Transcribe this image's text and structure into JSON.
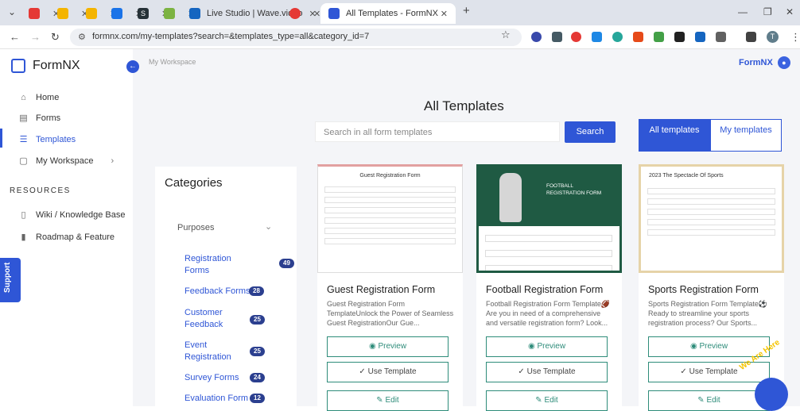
{
  "browser": {
    "tabs": [
      {
        "label": "",
        "color": "#e53935"
      },
      {
        "label": "",
        "color": "#f4b400"
      },
      {
        "label": "",
        "color": "#f4b400"
      },
      {
        "label": "",
        "color": "#1a73e8"
      },
      {
        "label": "S",
        "color": "#263238"
      },
      {
        "label": "",
        "color": "#7cb342"
      },
      {
        "label": "Live Studio | Wave.video",
        "color": "#1565c0"
      },
      {
        "label": "",
        "color": "#e53935"
      }
    ],
    "active_tab": "All Templates - FormNX",
    "new_tab": "+",
    "url": "formnx.com/my-templates?search=&templates_type=all&category_id=7",
    "profile_initial": "T"
  },
  "app": {
    "logo": "FormNX",
    "breadcrumb": "My Workspace",
    "brand_right": "FormNX",
    "nav": [
      {
        "label": "Home",
        "icon": "home-icon",
        "glyph": "⌂"
      },
      {
        "label": "Forms",
        "icon": "forms-icon",
        "glyph": "▤"
      },
      {
        "label": "Templates",
        "icon": "templates-icon",
        "glyph": "☰"
      },
      {
        "label": "My Workspace",
        "icon": "workspace-icon",
        "glyph": "▢"
      }
    ],
    "resources_label": "RESOURCES",
    "resources": [
      {
        "label": "Wiki / Knowledge Base",
        "icon": "book-icon"
      },
      {
        "label": "Roadmap & Feature",
        "icon": "roadmap-icon"
      }
    ],
    "page_title": "All Templates",
    "search_placeholder": "Search in all form templates",
    "search_button": "Search",
    "toggle": {
      "all": "All templates",
      "my": "My templates"
    },
    "support": "Support",
    "widget_text": "We Are Here"
  },
  "categories": {
    "title": "Categories",
    "group": "Purposes",
    "items": [
      {
        "label": "Registration Forms",
        "count": "49"
      },
      {
        "label": "Feedback Forms",
        "count": "28"
      },
      {
        "label": "Customer Feedback",
        "count": "25"
      },
      {
        "label": "Event Registration",
        "count": "25"
      },
      {
        "label": "Survey Forms",
        "count": "24"
      },
      {
        "label": "Evaluation Form",
        "count": "12"
      }
    ]
  },
  "cards": [
    {
      "thumb_title": "Guest Registration Form",
      "title": "Guest Registration Form",
      "desc": "Guest Registration Form TemplateUnlock the Power of Seamless Guest RegistrationOur Gue...",
      "preview": "Preview",
      "use": "Use Template",
      "edit": "Edit"
    },
    {
      "thumb_title": "FOOTBALL REGISTRATION FORM",
      "title": "Football Registration Form",
      "desc": "Football Registration Form Template🏈 Are you in need of a comprehensive and versatile registration form? Look...",
      "preview": "Preview",
      "use": "Use Template",
      "edit": "Edit"
    },
    {
      "thumb_title": "2023 The Spectacle Of Sports",
      "title": "Sports Registration Form",
      "desc": "Sports Registration Form Template⚽ Ready to streamline your sports registration process? Our Sports...",
      "preview": "Preview",
      "use": "Use Template",
      "edit": "Edit"
    }
  ],
  "colors": {
    "accent": "#2f56d6",
    "teal": "#2e8c7a",
    "football_green": "#1f5a43"
  }
}
